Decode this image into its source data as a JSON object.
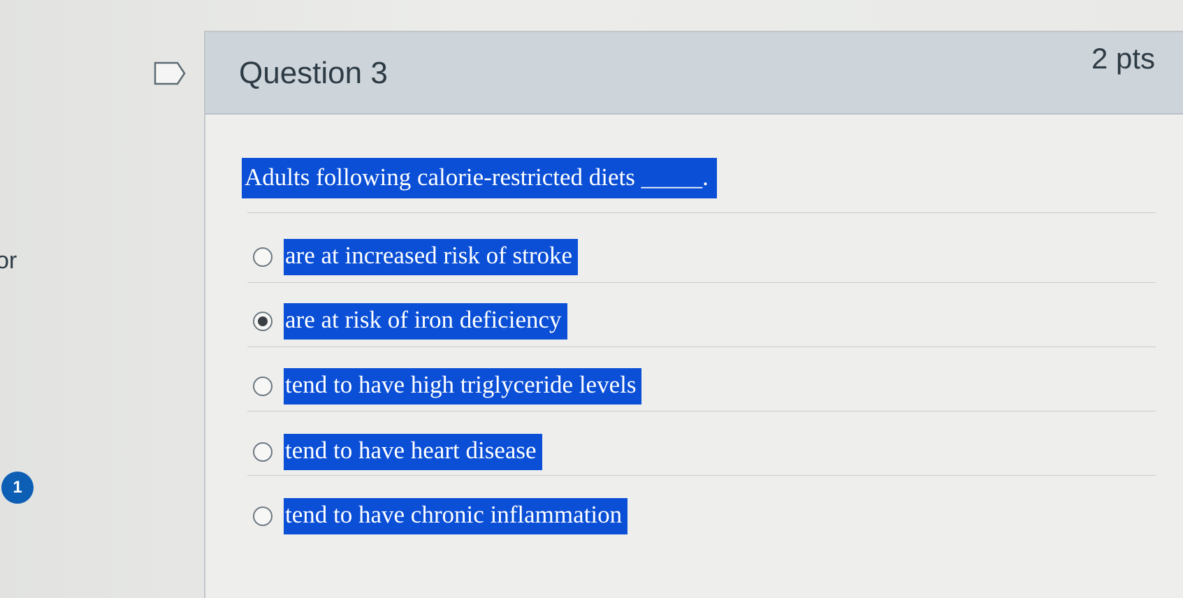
{
  "sidebar": {
    "partial_text": "or",
    "badge_count": "1"
  },
  "question": {
    "title": "Question 3",
    "points": "2 pts",
    "prompt": "Adults following calorie-restricted diets _____.",
    "answers": [
      {
        "label": "are at increased risk of stroke",
        "selected": false
      },
      {
        "label": "are at risk of iron deficiency",
        "selected": true
      },
      {
        "label": "tend to have high triglyceride levels",
        "selected": false
      },
      {
        "label": "tend to have heart disease",
        "selected": false
      },
      {
        "label": "tend to have chronic inflammation",
        "selected": false
      }
    ]
  },
  "colors": {
    "highlight": "#0a4fd6",
    "header_bg": "#cdd4da",
    "badge": "#0d5fb5",
    "text": "#2d3b45"
  }
}
